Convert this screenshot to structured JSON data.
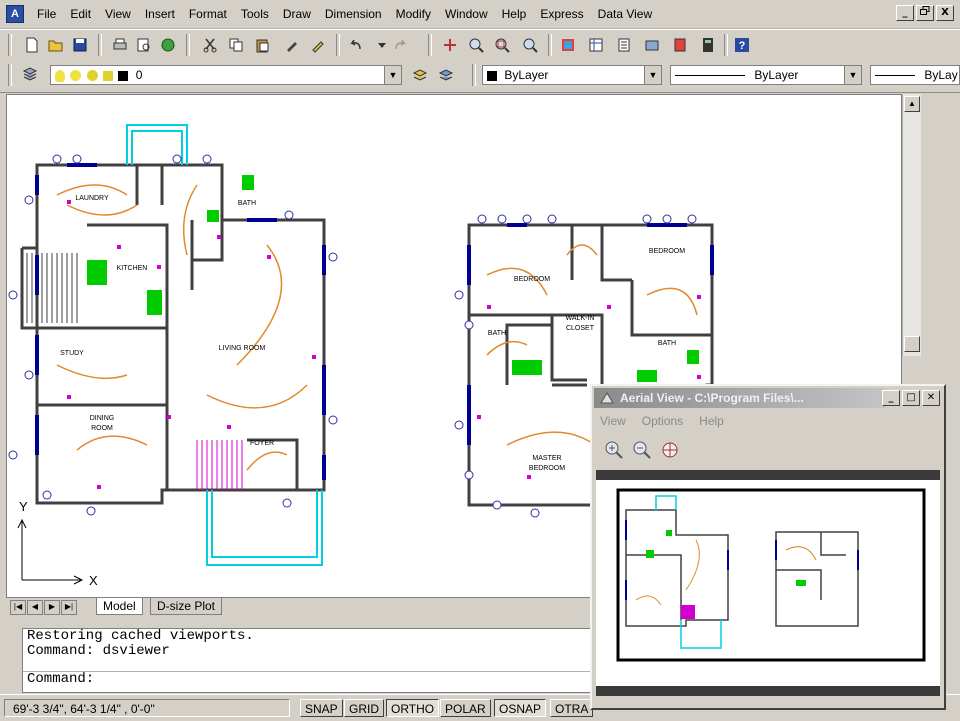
{
  "menubar": {
    "app_icon": "autocad-icon",
    "items": [
      "File",
      "Edit",
      "View",
      "Insert",
      "Format",
      "Tools",
      "Draw",
      "Dimension",
      "Modify",
      "Window",
      "Help",
      "Express",
      "Data View"
    ],
    "window_controls": [
      "_",
      "Ё",
      "X"
    ]
  },
  "layers": {
    "current_layer": "0",
    "color": "ByLayer",
    "linetype": "ByLayer",
    "lineweight": "ByLay"
  },
  "tabs": {
    "model": "Model",
    "layout": "D-size Plot"
  },
  "command": {
    "lines": [
      "Restoring cached viewports.",
      "Command: dsviewer"
    ],
    "prompt": "Command:"
  },
  "status": {
    "coordinates": "69'-3 3/4\", 64'-3 1/4\" , 0'-0\"",
    "buttons": [
      "SNAP",
      "GRID",
      "ORTHO",
      "POLAR",
      "OSNAP",
      "OTRA"
    ]
  },
  "aerial": {
    "title": "Aerial View - C:\\Program Files\\...",
    "menu": [
      "View",
      "Options",
      "Help"
    ]
  },
  "drawing": {
    "ucs_y": "Y",
    "ucs_x": "X",
    "rooms": {
      "laundry": "LAUNDRY",
      "kitchen": "KITCHEN",
      "bath": "BATH",
      "study": "STUDY",
      "dining": "DINING",
      "room": "ROOM",
      "living": "LIVING ROOM",
      "foyer": "FOYER",
      "bedroom1": "BEDROOM",
      "bedroom2": "BEDROOM",
      "walkin": "WALK-IN",
      "closet": "CLOSET",
      "master": "MASTER",
      "master_bed": "BEDROOM",
      "bath2": "BATH",
      "bath3": "BATH"
    }
  },
  "colors": {
    "wall": "#404040",
    "window": "#000090",
    "dimension": "#3030a0",
    "wire": "#e08a2c",
    "outlet": "#d000d0",
    "fixture": "#00cc00",
    "porch": "#00d0e0"
  }
}
